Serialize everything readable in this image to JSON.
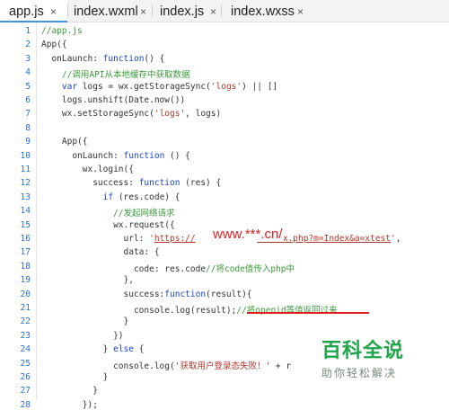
{
  "tabs": [
    {
      "label": "app.js",
      "close": "×",
      "active": true
    },
    {
      "label": "index.wxml",
      "close": "×",
      "active": false
    },
    {
      "label": "index.js",
      "close": "×",
      "active": false
    },
    {
      "label": "index.wxss",
      "close": "×",
      "active": false
    }
  ],
  "code_lines": [
    {
      "no": "1",
      "indent": "",
      "segs": [
        [
          "cm",
          "//app.js"
        ]
      ]
    },
    {
      "no": "2",
      "indent": "",
      "segs": [
        [
          "plain",
          "App({"
        ]
      ]
    },
    {
      "no": "3",
      "indent": "  ",
      "segs": [
        [
          "plain",
          "onLaunch: "
        ],
        [
          "kw",
          "function"
        ],
        [
          "plain",
          "() {"
        ]
      ]
    },
    {
      "no": "4",
      "indent": "    ",
      "segs": [
        [
          "cm",
          "//调用API从本地缓存中获取数据"
        ]
      ]
    },
    {
      "no": "5",
      "indent": "    ",
      "segs": [
        [
          "kw",
          "var"
        ],
        [
          "plain",
          " logs = wx.getStorageSync("
        ],
        [
          "str",
          "'logs'"
        ],
        [
          "plain",
          ") || []"
        ]
      ]
    },
    {
      "no": "6",
      "indent": "    ",
      "segs": [
        [
          "plain",
          "logs.unshift(Date.now())"
        ]
      ]
    },
    {
      "no": "7",
      "indent": "    ",
      "segs": [
        [
          "plain",
          "wx.setStorageSync("
        ],
        [
          "str",
          "'logs'"
        ],
        [
          "plain",
          ", logs)"
        ]
      ]
    },
    {
      "no": "8",
      "indent": "",
      "segs": []
    },
    {
      "no": "9",
      "indent": "    ",
      "segs": [
        [
          "plain",
          "App({"
        ]
      ]
    },
    {
      "no": "10",
      "indent": "      ",
      "segs": [
        [
          "plain",
          "onLaunch: "
        ],
        [
          "kw",
          "function"
        ],
        [
          "plain",
          " () {"
        ]
      ]
    },
    {
      "no": "11",
      "indent": "        ",
      "segs": [
        [
          "plain",
          "wx.login({"
        ]
      ]
    },
    {
      "no": "12",
      "indent": "          ",
      "segs": [
        [
          "plain",
          "success: "
        ],
        [
          "kw",
          "function"
        ],
        [
          "plain",
          " (res) {"
        ]
      ]
    },
    {
      "no": "13",
      "indent": "            ",
      "segs": [
        [
          "kw",
          "if"
        ],
        [
          "plain",
          " (res.code) {"
        ]
      ]
    },
    {
      "no": "14",
      "indent": "              ",
      "segs": [
        [
          "cm",
          "//发起网络请求"
        ]
      ]
    },
    {
      "no": "15",
      "indent": "              ",
      "segs": [
        [
          "plain",
          "wx.request({"
        ]
      ]
    },
    {
      "no": "16",
      "indent": "                ",
      "segs": [
        [
          "plain",
          "url: "
        ],
        [
          "str",
          "'"
        ],
        [
          "url",
          "https://"
        ],
        [
          "plain",
          "            "
        ],
        [
          "url",
          "/index.php?m=Index&a=xtest"
        ],
        [
          "str",
          "'"
        ],
        [
          "plain",
          ","
        ]
      ]
    },
    {
      "no": "17",
      "indent": "                ",
      "segs": [
        [
          "plain",
          "data: {"
        ]
      ]
    },
    {
      "no": "18",
      "indent": "                  ",
      "segs": [
        [
          "plain",
          "code: res.code"
        ],
        [
          "cm",
          "//将code值传入php中"
        ]
      ]
    },
    {
      "no": "19",
      "indent": "                ",
      "segs": [
        [
          "plain",
          "},"
        ]
      ]
    },
    {
      "no": "20",
      "indent": "                ",
      "segs": [
        [
          "plain",
          "success:"
        ],
        [
          "kw",
          "function"
        ],
        [
          "plain",
          "(result){"
        ]
      ]
    },
    {
      "no": "21",
      "indent": "                  ",
      "segs": [
        [
          "plain",
          "console.log(result);"
        ],
        [
          "cm",
          "//将openid等值返回过来"
        ]
      ]
    },
    {
      "no": "22",
      "indent": "                ",
      "segs": [
        [
          "plain",
          "}"
        ]
      ]
    },
    {
      "no": "23",
      "indent": "              ",
      "segs": [
        [
          "plain",
          "})"
        ]
      ]
    },
    {
      "no": "24",
      "indent": "            ",
      "segs": [
        [
          "plain",
          "} "
        ],
        [
          "kw",
          "else"
        ],
        [
          "plain",
          " {"
        ]
      ]
    },
    {
      "no": "25",
      "indent": "              ",
      "segs": [
        [
          "plain",
          "console.log("
        ],
        [
          "str",
          "'获取用户登录态失败！'"
        ],
        [
          "plain",
          " + r"
        ]
      ]
    },
    {
      "no": "26",
      "indent": "            ",
      "segs": [
        [
          "plain",
          "}"
        ]
      ]
    },
    {
      "no": "27",
      "indent": "          ",
      "segs": [
        [
          "plain",
          "}"
        ]
      ]
    },
    {
      "no": "28",
      "indent": "        ",
      "segs": [
        [
          "plain",
          "});"
        ]
      ]
    }
  ],
  "overlay_url": "www.***.cn/",
  "watermark": {
    "title": "百科全说",
    "subtitle": "助你轻松解决"
  },
  "colors": {
    "accent": "#4a90d9",
    "line_number": "#2b6fd6",
    "keyword": "#1a45c9",
    "string": "#b0372a",
    "comment": "#3a9a3a",
    "highlight": "#e02020",
    "watermark": "#1fa64a"
  }
}
